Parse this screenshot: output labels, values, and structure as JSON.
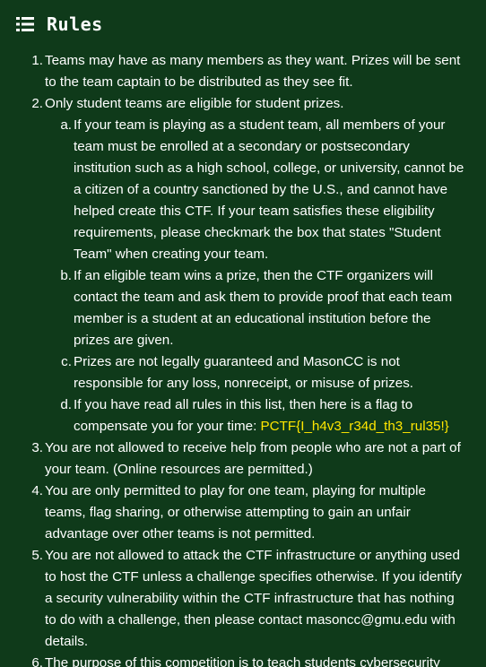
{
  "header": {
    "title": "Rules",
    "icon": "list-icon"
  },
  "rules": [
    {
      "text": "Teams may have as many members as they want. Prizes will be sent to the team captain to be distributed as they see fit."
    },
    {
      "text": "Only student teams are eligible for student prizes."
    },
    {
      "text": "You are not allowed to receive help from people who are not a part of your team. (Online resources are permitted.)"
    },
    {
      "text": "You are only permitted to play for one team, playing for multiple teams, flag sharing, or otherwise attempting to gain an unfair advantage over other teams is not permitted."
    },
    {
      "text": "You are not allowed to attack the CTF infrastructure or anything used to host the CTF unless a challenge specifies otherwise. If you identify a security vulnerability within the CTF infrastructure that has nothing to do with a challenge, then please contact masoncc@gmu.edu with details."
    },
    {
      "text": "The purpose of this competition is to teach students cybersecurity"
    }
  ],
  "subrules": [
    {
      "text": "If your team is playing as a student team, all members of your team must be enrolled at a secondary or postsecondary institution such as a high school, college, or university, cannot be a citizen of a country sanctioned by the U.S., and cannot have helped create this CTF. If your team satisfies these eligibility requirements, please checkmark the box that states \"Student Team\" when creating your team."
    },
    {
      "text": "If an eligible team wins a prize, then the CTF organizers will contact the team and ask them to provide proof that each team member is a student at an educational institution before the prizes are given."
    },
    {
      "text": "Prizes are not legally guaranteed and MasonCC is not responsible for any loss, nonreceipt, or misuse of prizes."
    },
    {
      "text": "If you have read all rules in this list, then here is a flag to compensate you for your time: ",
      "flag": "PCTF{I_h4v3_r34d_th3_rul35!}"
    }
  ],
  "colors": {
    "background": "#0f3a1a",
    "text": "#ffffff",
    "flag": "#ffe600"
  }
}
